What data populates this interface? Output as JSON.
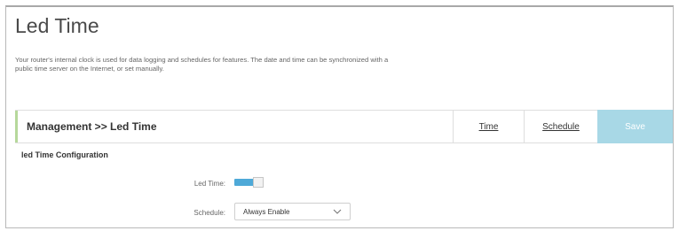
{
  "page": {
    "title": "Led Time",
    "description": "Your router's internal clock is used for data logging and schedules for features. The date and time can be synchronized with a public time server on the Internet, or set manually."
  },
  "header": {
    "breadcrumb": "Management >> Led Time",
    "tabs": [
      {
        "label": "Time"
      },
      {
        "label": "Schedule"
      }
    ],
    "save_label": "Save"
  },
  "section": {
    "title": "led Time Configuration",
    "led_time": {
      "label": "Led Time:",
      "enabled": true
    },
    "schedule": {
      "label": "Schedule:",
      "value": "Always Enable"
    }
  },
  "colors": {
    "accent": "#4ea9d8",
    "save_bg": "#a8d8e6",
    "header_accent": "#b6d89b"
  },
  "icons": {
    "schedule_dropdown": "chevron-down-icon"
  }
}
